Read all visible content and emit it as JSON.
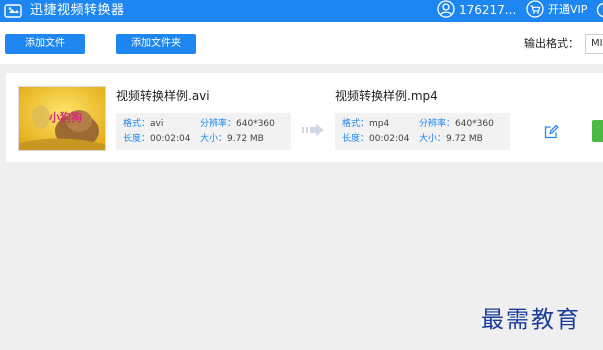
{
  "titlebar": {
    "app_title": "迅捷视频转换器",
    "user_id": "176217...",
    "vip_label": "开通VIP"
  },
  "toolbar": {
    "add_file_label": "添加文件",
    "add_folder_label": "添加文件夹",
    "output_format_label": "输出格式：",
    "output_format_value": "MI"
  },
  "file_item": {
    "thumbnail_text": "小狗狗",
    "source": {
      "name": "视频转换样例.avi",
      "format_label": "格式：",
      "format": "avi",
      "resolution_label": "分辨率：",
      "resolution": "640*360",
      "duration_label": "长度：",
      "duration": "00:02:04",
      "size_label": "大小：",
      "size": "9.72 MB"
    },
    "output": {
      "name": "视频转换样例.mp4",
      "format_label": "格式：",
      "format": "mp4",
      "resolution_label": "分辨率：",
      "resolution": "640*360",
      "duration_label": "长度：",
      "duration": "00:02:04",
      "size_label": "大小：",
      "size": "9.72 MB"
    }
  },
  "watermark": "最需教育",
  "colors": {
    "accent": "#1e86f0",
    "convert_green": "#4cb944",
    "watermark": "#1a3c9a"
  },
  "icons": [
    "app-logo-icon",
    "user-icon",
    "cart-icon",
    "more-icon",
    "arrow-right-icon",
    "edit-icon"
  ]
}
